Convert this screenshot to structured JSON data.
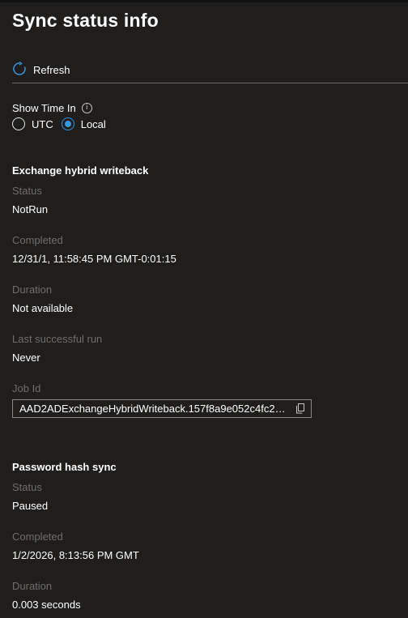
{
  "page": {
    "title": "Sync status info"
  },
  "toolbar": {
    "refresh_label": "Refresh"
  },
  "time_setting": {
    "label": "Show Time In",
    "options": [
      "UTC",
      "Local"
    ],
    "selected": "Local"
  },
  "exchange": {
    "title": "Exchange hybrid writeback",
    "status_label": "Status",
    "status_value": "NotRun",
    "completed_label": "Completed",
    "completed_value": "12/31/1, 11:58:45 PM GMT-0:01:15",
    "duration_label": "Duration",
    "duration_value": "Not available",
    "last_run_label": "Last successful run",
    "last_run_value": "Never",
    "jobid_label": "Job Id",
    "jobid_value": "AAD2ADExchangeHybridWriteback.157f8a9e052c4fc28b..."
  },
  "password": {
    "title": "Password hash sync",
    "status_label": "Status",
    "status_value": "Paused",
    "completed_label": "Completed",
    "completed_value": "1/2/2026, 8:13:56 PM GMT",
    "duration_label": "Duration",
    "duration_value": "0.003 seconds"
  },
  "colors": {
    "accent": "#3a96dd",
    "background": "#1f1e1d",
    "muted_label": "#6f6e6d"
  },
  "icons": {
    "refresh": "refresh-icon",
    "info": "info-icon",
    "copy": "copy-icon"
  }
}
